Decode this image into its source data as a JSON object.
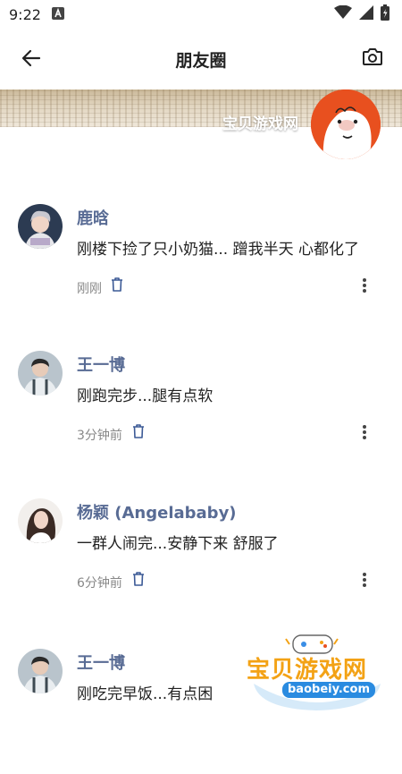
{
  "status_bar": {
    "time": "9:22",
    "notification_icon": "a-letter-icon",
    "wifi_icon": "wifi-icon",
    "signal_icon": "signal-icon",
    "battery_icon": "battery-icon"
  },
  "app_bar": {
    "title": "朋友圈",
    "back_icon": "arrow-left-icon",
    "camera_icon": "camera-icon"
  },
  "cover": {
    "username": "宝贝游戏网"
  },
  "posts": [
    {
      "name": "鹿晗",
      "content": "刚楼下捡了只小奶猫... 蹭我半天 心都化了",
      "time": "刚刚"
    },
    {
      "name": "王一博",
      "content": "刚跑完步...腿有点软",
      "time": "3分钟前"
    },
    {
      "name": "杨颖 (Angelababy)",
      "content": "一群人闹完...安静下来 舒服了",
      "time": "6分钟前"
    },
    {
      "name": "王一博",
      "content": "刚吃完早饭...有点困",
      "time": ""
    }
  ],
  "watermark": {
    "title": "宝贝游戏网",
    "url": "baobeiy.com"
  },
  "colors": {
    "name_color": "#586b94",
    "cover_avatar_bg": "#e8501f",
    "watermark_orange": "#f3a215",
    "watermark_blue": "#2a8be0"
  }
}
